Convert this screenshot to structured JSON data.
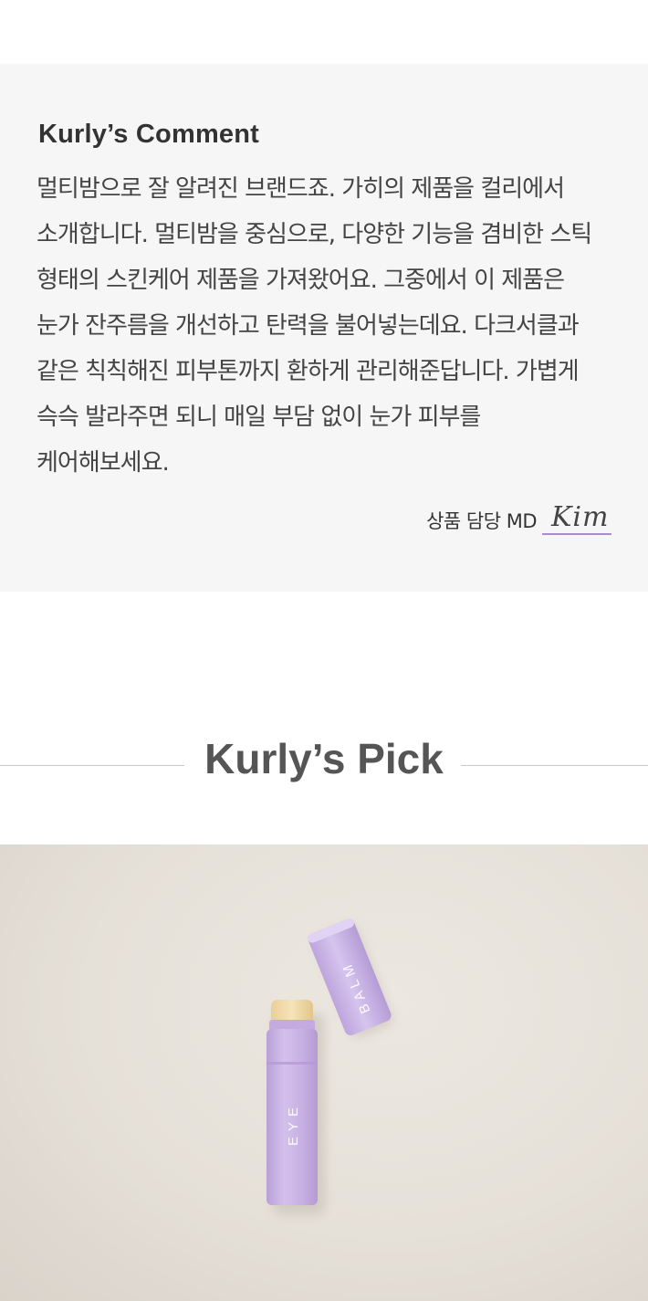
{
  "comment": {
    "title": "Kurly’s Comment",
    "body": "멀티밤으로 잘 알려진 브랜드죠. 가히의 제품을 컬리에서 소개합니다. 멀티밤을 중심으로, 다양한 기능을 겸비한 스틱 형태의 스킨케어 제품을 가져왔어요. 그중에서 이 제품은 눈가 잔주름을 개선하고 탄력을 불어넣는데요. 다크서클과 같은 칙칙해진 피부톤까지 환하게 관리해준답니다. 가볍게 슥슥 발라주면 되니 매일 부담 없이 눈가 피부를 케어해보세요.",
    "signature_label": "상품 담당 MD",
    "signature_name": "Kim"
  },
  "pick": {
    "title": "Kurly’s Pick"
  },
  "product_image": {
    "stick_label": "EYE",
    "cap_label": "BALM"
  },
  "colors": {
    "comment_bg": "#f6f6f6",
    "accent_underline": "#a98bd0",
    "product_lilac": "#c9b2e4",
    "photo_bg": "#e6e1d9"
  }
}
